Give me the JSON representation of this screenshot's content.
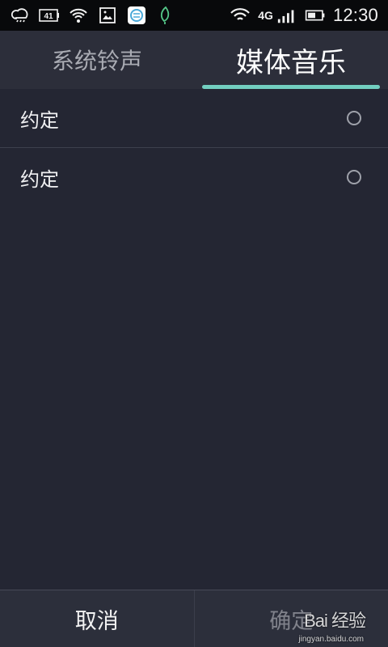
{
  "status_bar": {
    "notification_badge": "41",
    "network_label": "4G",
    "time": "12:30",
    "icons": [
      "weather-icon",
      "battery-notification-icon",
      "wifi-icon",
      "image-icon",
      "iflytek-app-icon",
      "green-leaf-icon",
      "wifi-signal-icon",
      "cell-signal-icon",
      "battery-icon"
    ]
  },
  "tabs": [
    {
      "label": "系统铃声",
      "selected": false
    },
    {
      "label": "媒体音乐",
      "selected": true
    }
  ],
  "music_list": [
    {
      "label": "约定",
      "selected": false
    },
    {
      "label": "约定",
      "selected": false
    }
  ],
  "actions": {
    "cancel": "取消",
    "confirm": "确定"
  },
  "watermark": {
    "brand": "Bai 经验",
    "url": "jingyan.baidu.com"
  },
  "colors": {
    "background": "#242633",
    "tab_background": "#2c2e3a",
    "tab_indicator": "#72cfc0",
    "status_bar": "#08090b",
    "inactive_text": "#a9abb3"
  }
}
